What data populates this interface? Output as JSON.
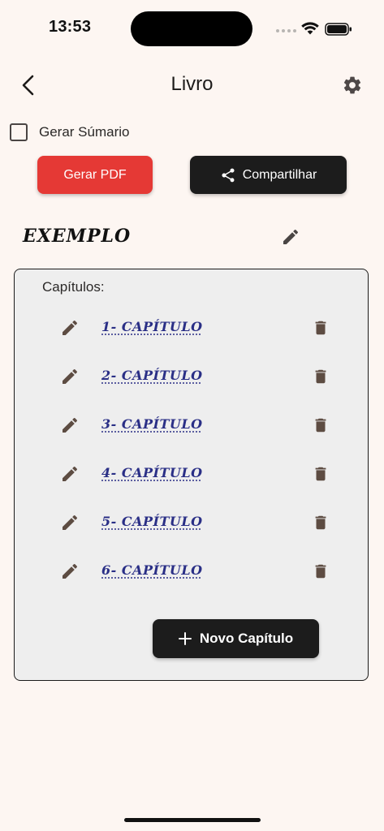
{
  "status_bar": {
    "time": "13:53"
  },
  "app_bar": {
    "title": "Livro",
    "back_icon": "arrow-back-icon",
    "settings_icon": "gear-icon"
  },
  "options": {
    "summary_label": "Gerar Súmario",
    "summary_checked": false
  },
  "actions": {
    "pdf_label": "Gerar PDF",
    "share_label": "Compartilhar",
    "pdf_color": "#e53935",
    "dark_color": "#1c1c1c"
  },
  "book": {
    "title": "EXEMPLO"
  },
  "chapters": {
    "heading": "Capítulos:",
    "items": [
      {
        "label": "1- CAPÍTULO"
      },
      {
        "label": "2- CAPÍTULO"
      },
      {
        "label": "3- CAPÍTULO"
      },
      {
        "label": "4- CAPÍTULO"
      },
      {
        "label": "5- CAPÍTULO"
      },
      {
        "label": "6- CAPÍTULO"
      }
    ],
    "new_label": "Novo Capítulo",
    "link_color": "#2a2f86",
    "icon_color": "#5d4c42"
  }
}
